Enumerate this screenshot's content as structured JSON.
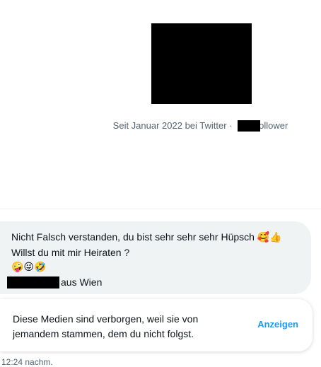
{
  "profile": {
    "joined_text": "Seit Januar 2022 bei Twitter · ",
    "followers_suffix": "ollower"
  },
  "message": {
    "line1": "Nicht Falsch verstanden, du bist sehr sehr  sehr Hüpsch ",
    "line1_emojis": "🥰👍",
    "line2": "Willst du mit mir Heiraten  ?",
    "line3_emojis": "🤪😜🤣",
    "sign_suffix": "aus Wien"
  },
  "media_notice": {
    "text": "Diese Medien sind verborgen, weil sie von jemandem stammen, dem du nicht folgst.",
    "button_label": "Anzeigen"
  },
  "timestamp": "12:24 nachm.",
  "colors": {
    "accent": "#1d9bf0",
    "bubble": "#eff3f4",
    "secondary_text": "#536471"
  }
}
